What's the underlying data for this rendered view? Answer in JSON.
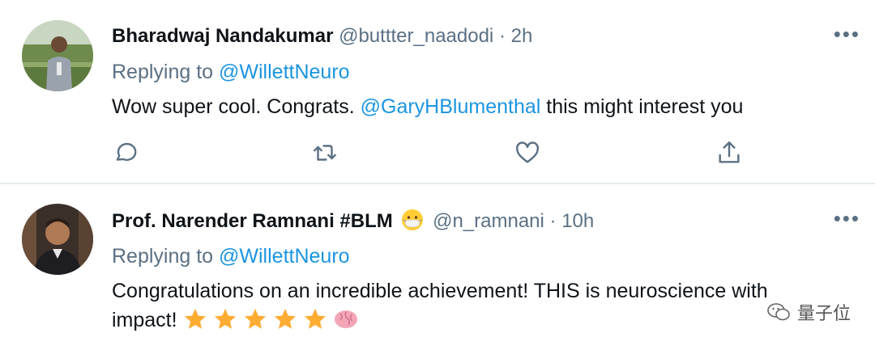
{
  "tweets": [
    {
      "name": "Bharadwaj Nandakumar",
      "handle": "@buttter_naadodi",
      "dot": "·",
      "time": "2h",
      "replying_prefix": "Replying to",
      "replying_to": "@WillettNeuro",
      "body_before": "Wow super cool. Congrats. ",
      "body_mention": "@GaryHBlumenthal",
      "body_after": " this might interest you",
      "more": "•••"
    },
    {
      "name": "Prof. Narender Ramnani #BLM",
      "handle": "@n_ramnani",
      "dot": "·",
      "time": "10h",
      "replying_prefix": "Replying to",
      "replying_to": "@WillettNeuro",
      "body": "Congratulations on an incredible achievement! THIS is neuroscience with",
      "body_line2": "impact!",
      "more": "•••"
    }
  ],
  "watermark": "量子位",
  "icons": [
    "reply-icon",
    "retweet-icon",
    "like-icon",
    "share-icon",
    "more-icon",
    "mask-emoji",
    "star-emoji",
    "brain-emoji",
    "wechat-icon"
  ],
  "colors": {
    "link": "#1b95e0",
    "muted": "#5b7083",
    "text": "#0f1419",
    "divider": "#e6ecf0"
  }
}
